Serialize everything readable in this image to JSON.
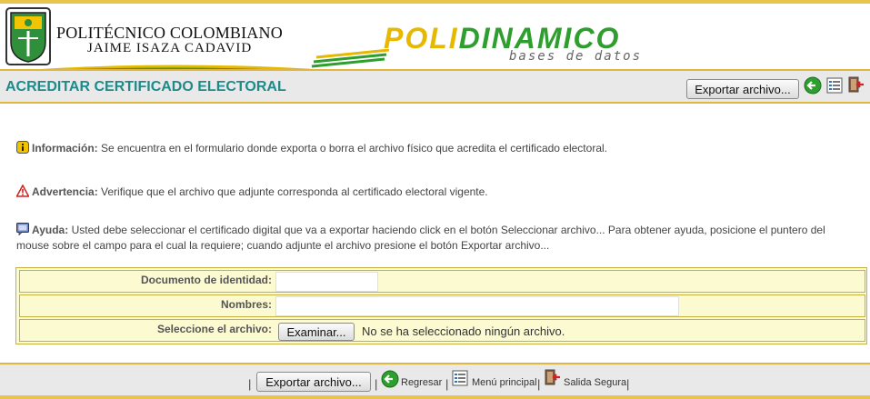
{
  "institution": {
    "name": "POLITÉCNICO COLOMBIANO",
    "subname": "JAIME ISAZA CADAVID"
  },
  "brand": {
    "logo_part1": "POLI",
    "logo_part2": "DINAMICO",
    "tagline": "bases de datos",
    "colors": {
      "yellow": "#e6b800",
      "green": "#2e9e2e",
      "title_teal": "#1f8a8a",
      "border_gold": "#e0b73c"
    }
  },
  "page": {
    "title": "ACREDITAR CERTIFICADO ELECTORAL",
    "export_button": "Exportar archivo...",
    "toolbar_icons": [
      "back-arrow-icon",
      "main-menu-icon",
      "secure-exit-icon"
    ]
  },
  "messages": {
    "info_label": "Información:",
    "info_text": " Se encuentra en el formulario donde exporta o borra el archivo físico que acredita el certificado electoral.",
    "warning_label": "Advertencia:",
    "warning_text": " Verifique que el archivo que adjunte corresponda al certificado electoral vigente.",
    "help_label": "Ayuda:",
    "help_text": " Usted debe seleccionar el certificado digital que va a exportar haciendo click en el botón Seleccionar archivo... Para obtener ayuda, posicione el puntero del mouse sobre el campo para el cual la requiere; cuando adjunte el archivo presione el botón Exportar archivo..."
  },
  "form": {
    "document_label": "Documento de identidad:",
    "document_value": "",
    "names_label": "Nombres:",
    "names_value": "",
    "file_label": "Seleccione el archivo:",
    "file_button": "Examinar...",
    "file_status": "No se ha seleccionado ningún archivo."
  },
  "footer": {
    "export_button": "Exportar archivo...",
    "back_label": "Regresar",
    "menu_label": "Menú principal",
    "exit_label": "Salida Segura",
    "separator": "|"
  }
}
